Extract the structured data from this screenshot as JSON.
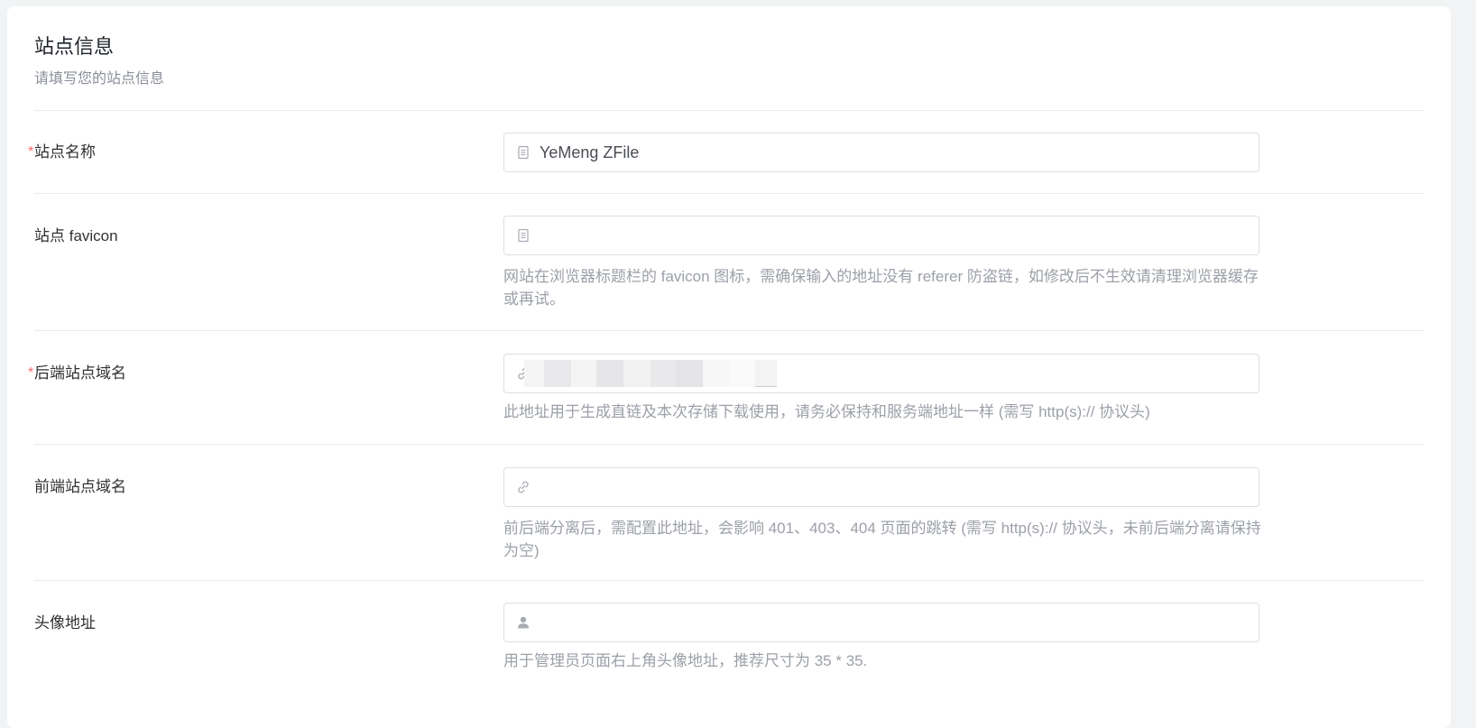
{
  "section": {
    "title": "站点信息",
    "subtitle": "请填写您的站点信息"
  },
  "fields": {
    "site_name": {
      "label": "站点名称",
      "required_mark": "*",
      "value": "YeMeng ZFile",
      "icon": "document-icon"
    },
    "favicon": {
      "label": "站点 favicon",
      "value": "",
      "icon": "document-icon",
      "help": "网站在浏览器标题栏的 favicon 图标，需确保输入的地址没有 referer 防盗链，如修改后不生效请清理浏览器缓存或再试。"
    },
    "backend_domain": {
      "label": "后端站点域名",
      "required_mark": "*",
      "value": "",
      "icon": "link-icon",
      "help": "此地址用于生成直链及本次存储下载使用，请务必保持和服务端地址一样 (需写 http(s):// 协议头)"
    },
    "frontend_domain": {
      "label": "前端站点域名",
      "value": "",
      "icon": "link-icon",
      "help": "前后端分离后，需配置此地址，会影响 401、403、404 页面的跳转 (需写 http(s):// 协议头，未前后端分离请保持为空)"
    },
    "avatar": {
      "label": "头像地址",
      "value": "",
      "icon": "user-icon",
      "help": "用于管理员页面右上角头像地址，推荐尺寸为 35 * 35."
    }
  },
  "colors": {
    "required": "#f56c6c",
    "border": "#dcdfe6",
    "help_text": "#9ca0a8"
  }
}
